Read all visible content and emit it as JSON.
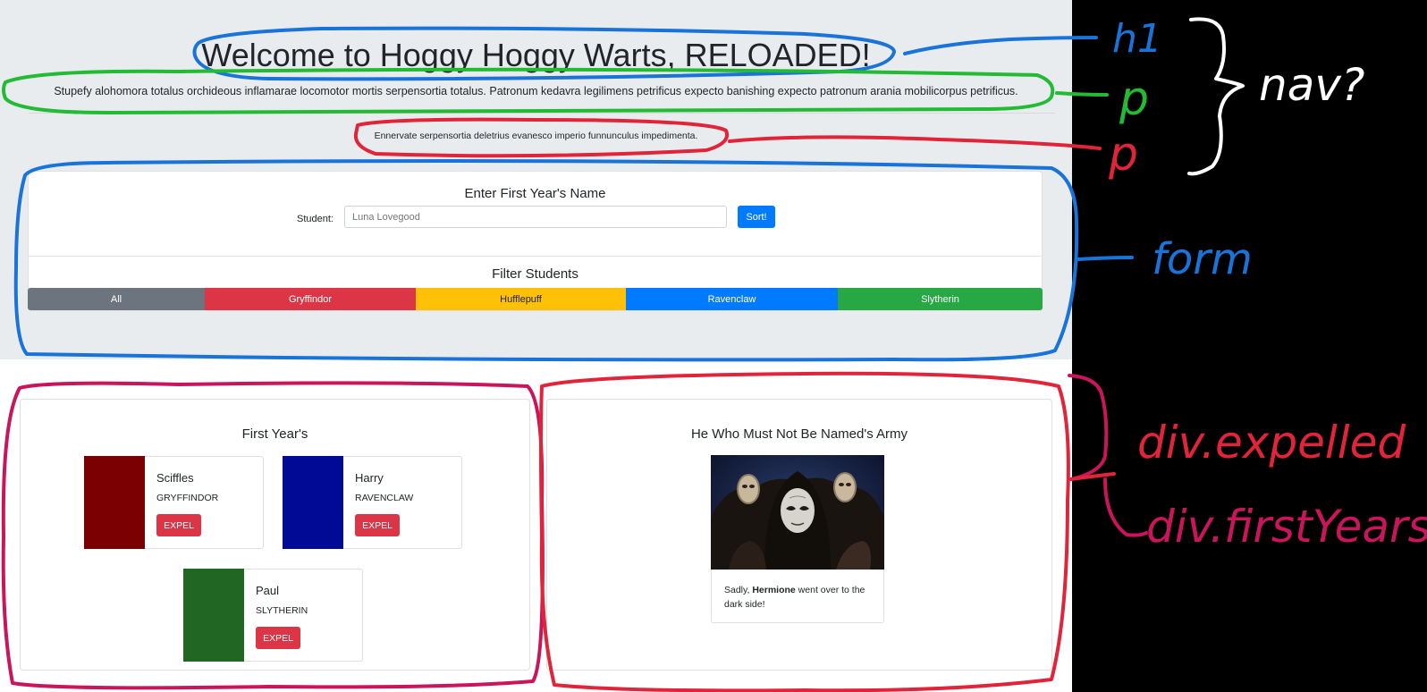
{
  "hero": {
    "title": "Welcome to Hoggy Hoggy Warts, RELOADED!",
    "lead": "Stupefy alohomora totalus orchideous inflamarae locomotor mortis serpensortia totalus. Patronum kedavra legilimens petrificus expecto banishing expecto patronum arania mobilicorpus petrificus.",
    "sub": "Ennervate serpensortia deletrius evanesco imperio funnunculus impedimenta."
  },
  "form": {
    "title": "Enter First Year's Name",
    "student_label": "Student:",
    "student_placeholder": "Luna Lovegood",
    "sort_label": "Sort!",
    "filter_title": "Filter Students",
    "filters": [
      "All",
      "Gryffindor",
      "Hufflepuff",
      "Ravenclaw",
      "Slytherin"
    ]
  },
  "first_years": {
    "title": "First Year's",
    "students": [
      {
        "name": "Sciffles",
        "house": "GRYFFINDOR",
        "color": "#7b0002",
        "expel": "EXPEL"
      },
      {
        "name": "Harry",
        "house": "RAVENCLAW",
        "color": "#010a94",
        "expel": "EXPEL"
      },
      {
        "name": "Paul",
        "house": "SLYTHERIN",
        "color": "#216622",
        "expel": "EXPEL"
      }
    ]
  },
  "army": {
    "title": "He Who Must Not Be Named's Army",
    "text_prefix": "Sadly, ",
    "text_name": "Hermione",
    "text_suffix": " went over to the dark side!"
  },
  "annotations": {
    "h1": "h1",
    "p1": "p",
    "p2": "p",
    "nav": "nav?",
    "form": "form",
    "expelled": "div.expelled",
    "firstYears": "div.firstYears"
  },
  "colors": {
    "blue": "#1a73d8",
    "green": "#22bb33",
    "red": "#e0243a",
    "magenta": "#c8155b",
    "white": "#ffffff"
  }
}
